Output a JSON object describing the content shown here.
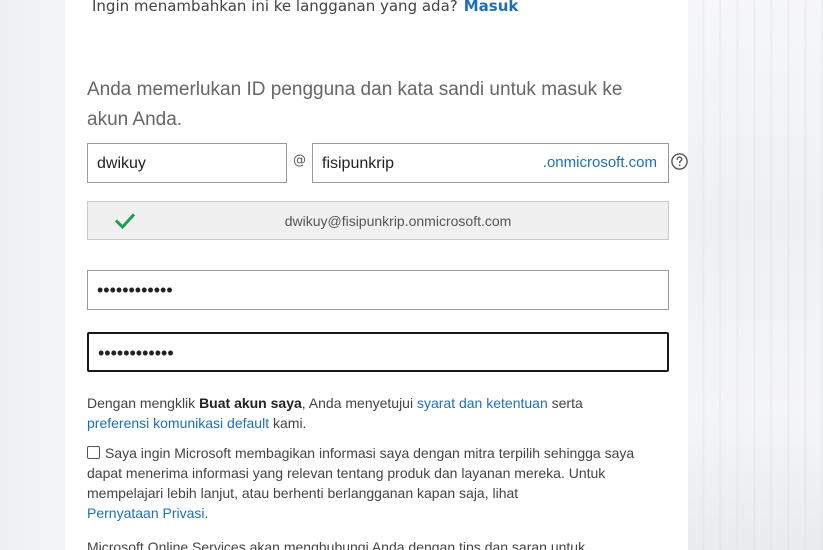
{
  "existing_account": {
    "prompt": "Ingin menambahkan ini ke langganan yang ada?",
    "link": "Masuk"
  },
  "intro": "Anda memerlukan ID pengguna dan kata sandi untuk masuk ke akun Anda.",
  "username": {
    "value": "dwikuy"
  },
  "at_symbol": "@",
  "domain": {
    "value": "fisipunkrip",
    "suffix": ".onmicrosoft.com"
  },
  "confirmation": {
    "text": "dwikuy@fisipunkrip.onmicrosoft.com",
    "icon": "check-icon",
    "color": "#1e9e4f"
  },
  "password": {
    "masked": "••••••••••••"
  },
  "confirm_password": {
    "masked": "••••••••••••"
  },
  "terms": {
    "prefix": "Dengan mengklik ",
    "bold": "Buat akun saya",
    "middle": ", Anda menyetujui ",
    "link1": "syarat dan ketentuan",
    "and": " serta",
    "link2": "preferensi komunikasi default",
    "suffix": " kami."
  },
  "consent": {
    "text": "Saya ingin Microsoft membagikan informasi saya dengan mitra terpilih sehingga saya dapat menerima informasi yang relevan tentang produk dan layanan mereka. Untuk mempelajari lebih lanjut, atau berhenti berlangganan kapan saja, lihat",
    "link": "Pernyataan Privasi",
    "end": "."
  },
  "footer": "Microsoft Online Services akan menghubungi Anda dengan tips dan saran untuk",
  "colors": {
    "link": "#1e6fb8",
    "check": "#1e9e4f"
  }
}
